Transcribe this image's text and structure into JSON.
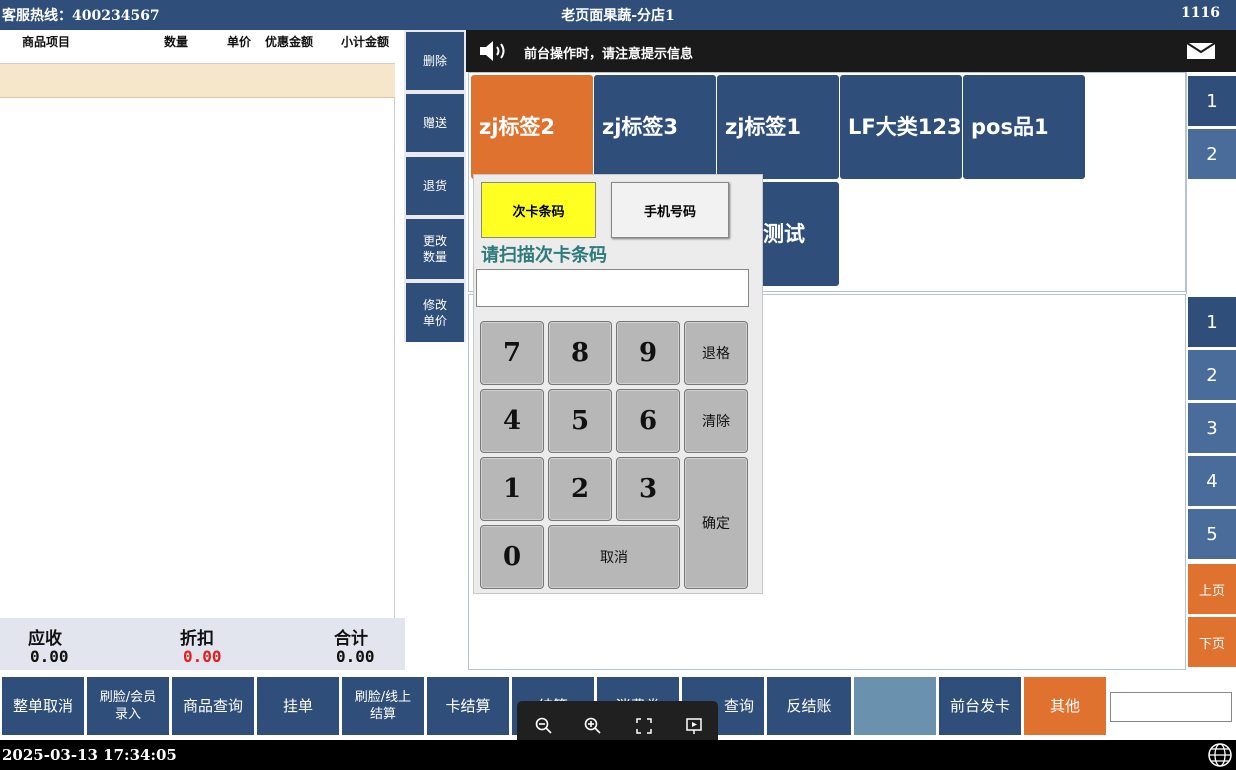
{
  "topbar": {
    "hotline": "客服热线：400234567",
    "store": "老页面果蔬-分店1",
    "number": "1116"
  },
  "order": {
    "columns": {
      "item": "商品项目",
      "qty": "数量",
      "price": "单价",
      "discount": "优惠金额",
      "subtotal": "小计金额"
    }
  },
  "totals": {
    "receivable_label": "应收",
    "receivable": "0.00",
    "discount_label": "折扣",
    "discount": "0.00",
    "total_label": "合计",
    "total": "0.00",
    "discount_color": "#e02020"
  },
  "side_actions": [
    "删除",
    "赠送",
    "退货",
    "更改数量",
    "修改单价"
  ],
  "notice": {
    "text": "前台操作时，请注意提示信息",
    "speaker_icon": "speaker-icon",
    "mail_icon": "mail-icon"
  },
  "categories": [
    {
      "label": "zj标签2",
      "active": true
    },
    {
      "label": "zj标签3",
      "active": false
    },
    {
      "label": "zj标签1",
      "active": false
    },
    {
      "label": "LF大类123",
      "active": false
    },
    {
      "label": "pos品1",
      "active": false
    },
    {
      "label": "测试",
      "active": false
    }
  ],
  "category_pages": [
    "1",
    "2"
  ],
  "product_pages": [
    "1",
    "2",
    "3",
    "4",
    "5"
  ],
  "paging": {
    "prev": "上页",
    "next": "下页"
  },
  "dialog": {
    "tab_card": "次卡条码",
    "tab_phone": "手机号码",
    "prompt": "请扫描次卡条码",
    "input_value": "",
    "keys": [
      "7",
      "8",
      "9",
      "4",
      "5",
      "6",
      "1",
      "2",
      "3",
      "0"
    ],
    "backspace": "退格",
    "clear": "清除",
    "confirm": "确定",
    "cancel": "取消"
  },
  "functions": {
    "cancel_order": "整单取消",
    "face_member": "刷脸/会员录入",
    "product_query": "商品查询",
    "hold": "挂单",
    "face_online": "刷脸/线上结算",
    "card_checkout": "卡结算",
    "checkout": "结算",
    "other_coupon": "消费券",
    "query": "查询",
    "reverse": "反结账",
    "blank": "",
    "issue_card": "前台发卡",
    "other": "其他"
  },
  "zoom": {
    "zoom_out": "zoom-out-icon",
    "zoom_in": "zoom-in-icon",
    "fit": "fit-screen-icon",
    "present": "present-icon"
  },
  "status": {
    "datetime": "2025-03-13 17:34:05",
    "globe_icon": "globe-icon"
  },
  "colors": {
    "primary": "#2f4f7a",
    "accent": "#e07230",
    "highlight": "#ffff22"
  }
}
